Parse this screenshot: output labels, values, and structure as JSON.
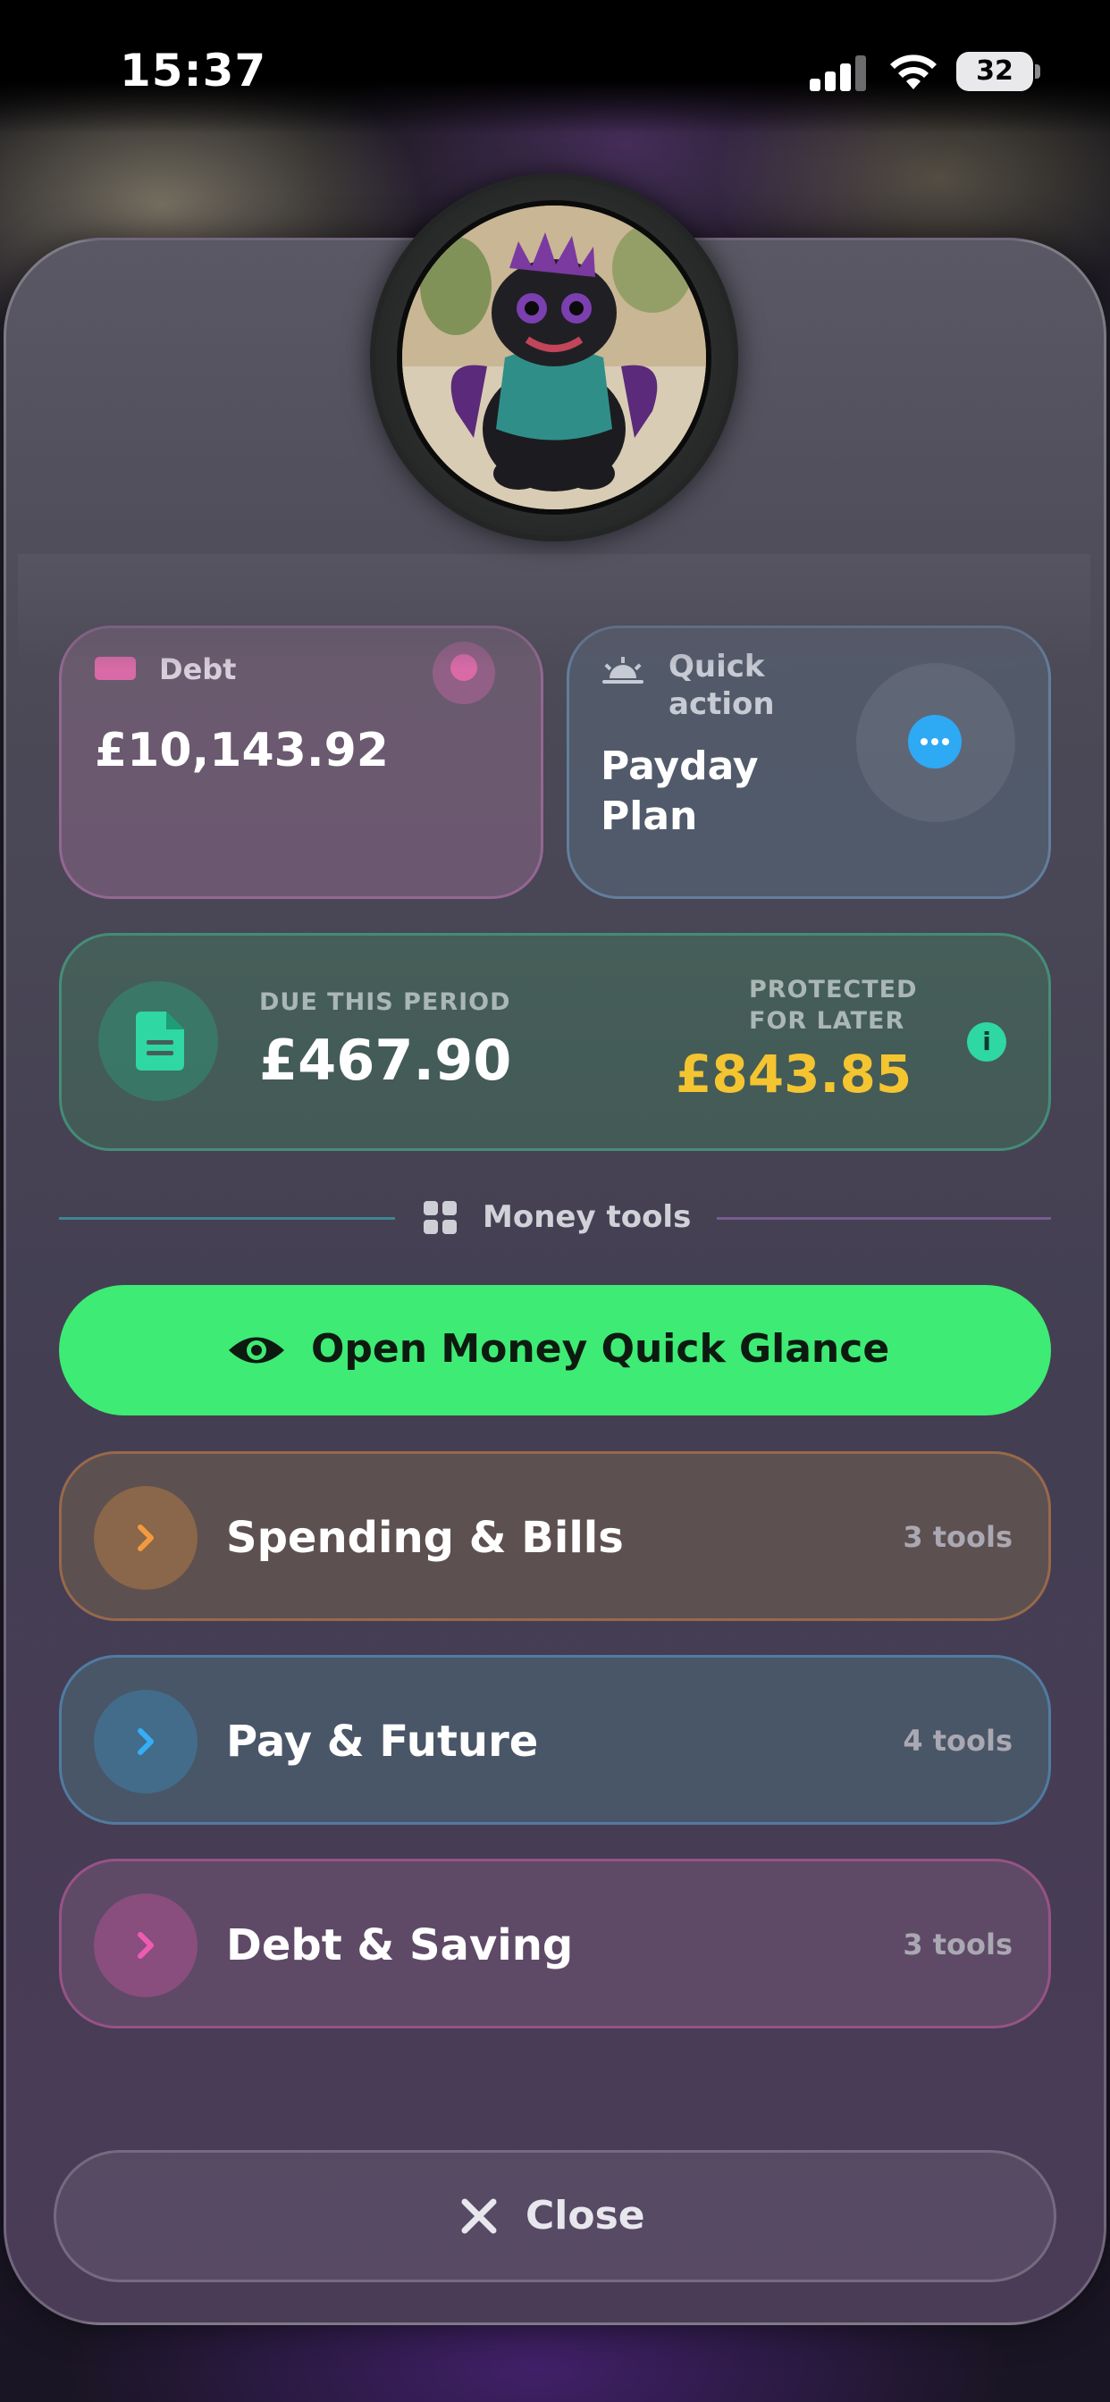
{
  "status_bar": {
    "time": "15:37",
    "battery": "32"
  },
  "debt_card": {
    "label": "Debt",
    "amount": "£10,143.92"
  },
  "quick_action": {
    "label": "Quick action",
    "title": "Payday Plan"
  },
  "period_card": {
    "due_label": "DUE THIS PERIOD",
    "due_amount": "£467.90",
    "protected_label_line1": "PROTECTED",
    "protected_label_line2": "FOR LATER",
    "protected_amount": "£843.85",
    "info_glyph": "i"
  },
  "section": {
    "label": "Money tools"
  },
  "glance_button": {
    "label": "Open Money Quick Glance"
  },
  "tool_groups": [
    {
      "title": "Spending & Bills",
      "count": "3 tools",
      "accent": "#f39a3f"
    },
    {
      "title": "Pay & Future",
      "count": "4 tools",
      "accent": "#35aef5"
    },
    {
      "title": "Debt & Saving",
      "count": "3 tools",
      "accent": "#ee5bb3"
    }
  ],
  "close_button": {
    "label": "Close"
  },
  "colors": {
    "accent_green": "#3eeb74",
    "amount_yellow": "#f4c531",
    "info_teal": "#2fd7a2"
  }
}
